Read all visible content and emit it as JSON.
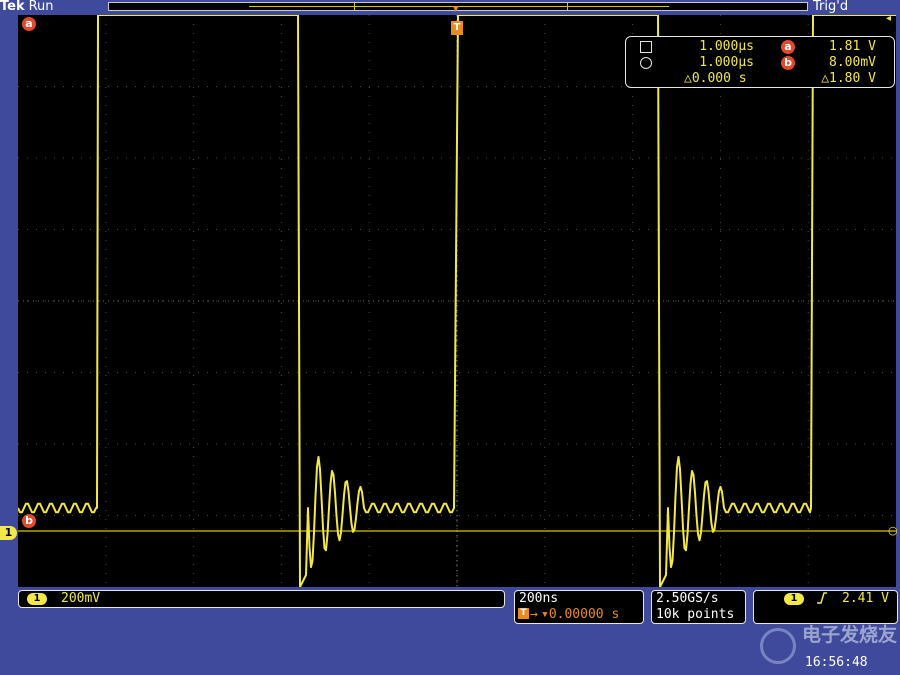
{
  "header": {
    "brand": "Tek",
    "run_state": "Run",
    "trigger_status": "Trig'd"
  },
  "markers": {
    "cursor_a": "a",
    "cursor_b": "b",
    "channel": "1",
    "trigger": "T"
  },
  "cursor_readout": {
    "row1_time": "1.000µs",
    "row1_label": "a",
    "row1_value": "1.81 V",
    "row2_time": "1.000µs",
    "row2_label": "b",
    "row2_value": "8.00mV",
    "delta_time": "△0.000 s",
    "delta_value": "△1.80 V"
  },
  "status_bar": {
    "ch1_label": "1",
    "ch1_scale": "200mV",
    "timebase": "200ns",
    "trigger_position": "▾0.00000 s",
    "sample_rate": "2.50GS/s",
    "record_length": "10k points",
    "trigger_channel": "1",
    "trigger_slope_icon": "rising-edge",
    "trigger_level": "2.41 V"
  },
  "clock": "16:56:48",
  "watermark": "电子发烧友",
  "colors": {
    "background": "#3f4a9c",
    "trace": "#f2e84a",
    "cursor_a": "#e2492d",
    "trigger": "#e98b22"
  }
}
